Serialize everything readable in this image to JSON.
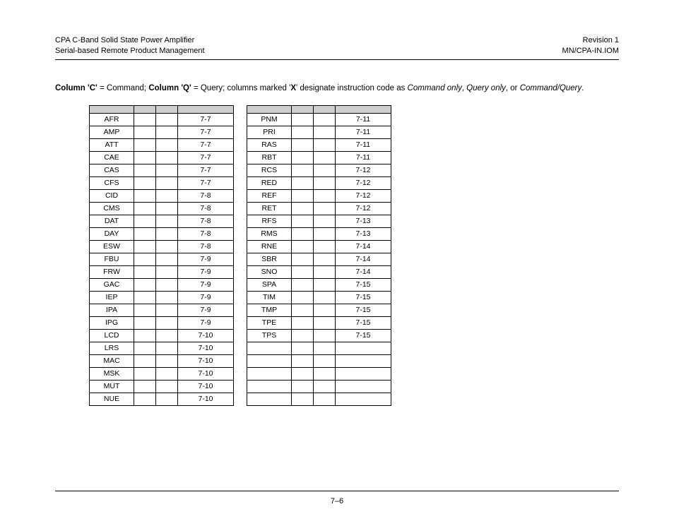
{
  "header": {
    "left_line1": "CPA C-Band Solid State Power Amplifier",
    "left_line2": "Serial-based Remote Product Management",
    "right_line1": "Revision 1",
    "right_line2": "MN/CPA-IN.IOM"
  },
  "intro": {
    "colC_label": "Column 'C'",
    "colC_def": " = Command; ",
    "colQ_label": "Column 'Q'",
    "colQ_def": " = Query; columns marked '",
    "x_label": "X",
    "after_x": "' designate instruction code as ",
    "cmd_only": "Command only",
    "sep1": ", ",
    "query_only": "Query only",
    "sep2": ", or ",
    "cmd_query": "Command/Query",
    "period": "."
  },
  "table_left": [
    {
      "code": "AFR",
      "page": "7-7"
    },
    {
      "code": "AMP",
      "page": "7-7"
    },
    {
      "code": "ATT",
      "page": "7-7"
    },
    {
      "code": "CAE",
      "page": "7-7"
    },
    {
      "code": "CAS",
      "page": "7-7"
    },
    {
      "code": "CFS",
      "page": "7-7"
    },
    {
      "code": "CID",
      "page": "7-8"
    },
    {
      "code": "CMS",
      "page": "7-8"
    },
    {
      "code": "DAT",
      "page": "7-8"
    },
    {
      "code": "DAY",
      "page": "7-8"
    },
    {
      "code": "ESW",
      "page": "7-8"
    },
    {
      "code": "FBU",
      "page": "7-9"
    },
    {
      "code": "FRW",
      "page": "7-9"
    },
    {
      "code": "GAC",
      "page": "7-9"
    },
    {
      "code": "IEP",
      "page": "7-9"
    },
    {
      "code": "IPA",
      "page": "7-9"
    },
    {
      "code": "IPG",
      "page": "7-9"
    },
    {
      "code": "LCD",
      "page": "7-10"
    },
    {
      "code": "LRS",
      "page": "7-10"
    },
    {
      "code": "MAC",
      "page": "7-10"
    },
    {
      "code": "MSK",
      "page": "7-10"
    },
    {
      "code": "MUT",
      "page": "7-10"
    },
    {
      "code": "NUE",
      "page": "7-10"
    }
  ],
  "table_right": [
    {
      "code": "PNM",
      "page": "7-11"
    },
    {
      "code": "PRI",
      "page": "7-11"
    },
    {
      "code": "RAS",
      "page": "7-11"
    },
    {
      "code": "RBT",
      "page": "7-11"
    },
    {
      "code": "RCS",
      "page": "7-12"
    },
    {
      "code": "RED",
      "page": "7-12"
    },
    {
      "code": "REF",
      "page": "7-12"
    },
    {
      "code": "RET",
      "page": "7-12"
    },
    {
      "code": "RFS",
      "page": "7-13"
    },
    {
      "code": "RMS",
      "page": "7-13"
    },
    {
      "code": "RNE",
      "page": "7-14"
    },
    {
      "code": "SBR",
      "page": "7-14"
    },
    {
      "code": "SNO",
      "page": "7-14"
    },
    {
      "code": "SPA",
      "page": "7-15"
    },
    {
      "code": "TIM",
      "page": "7-15"
    },
    {
      "code": "TMP",
      "page": "7-15"
    },
    {
      "code": "TPE",
      "page": "7-15"
    },
    {
      "code": "TPS",
      "page": "7-15"
    },
    {
      "code": "",
      "page": ""
    },
    {
      "code": "",
      "page": ""
    },
    {
      "code": "",
      "page": ""
    },
    {
      "code": "",
      "page": ""
    },
    {
      "code": "",
      "page": ""
    }
  ],
  "footer": {
    "page_number": "7–6"
  }
}
